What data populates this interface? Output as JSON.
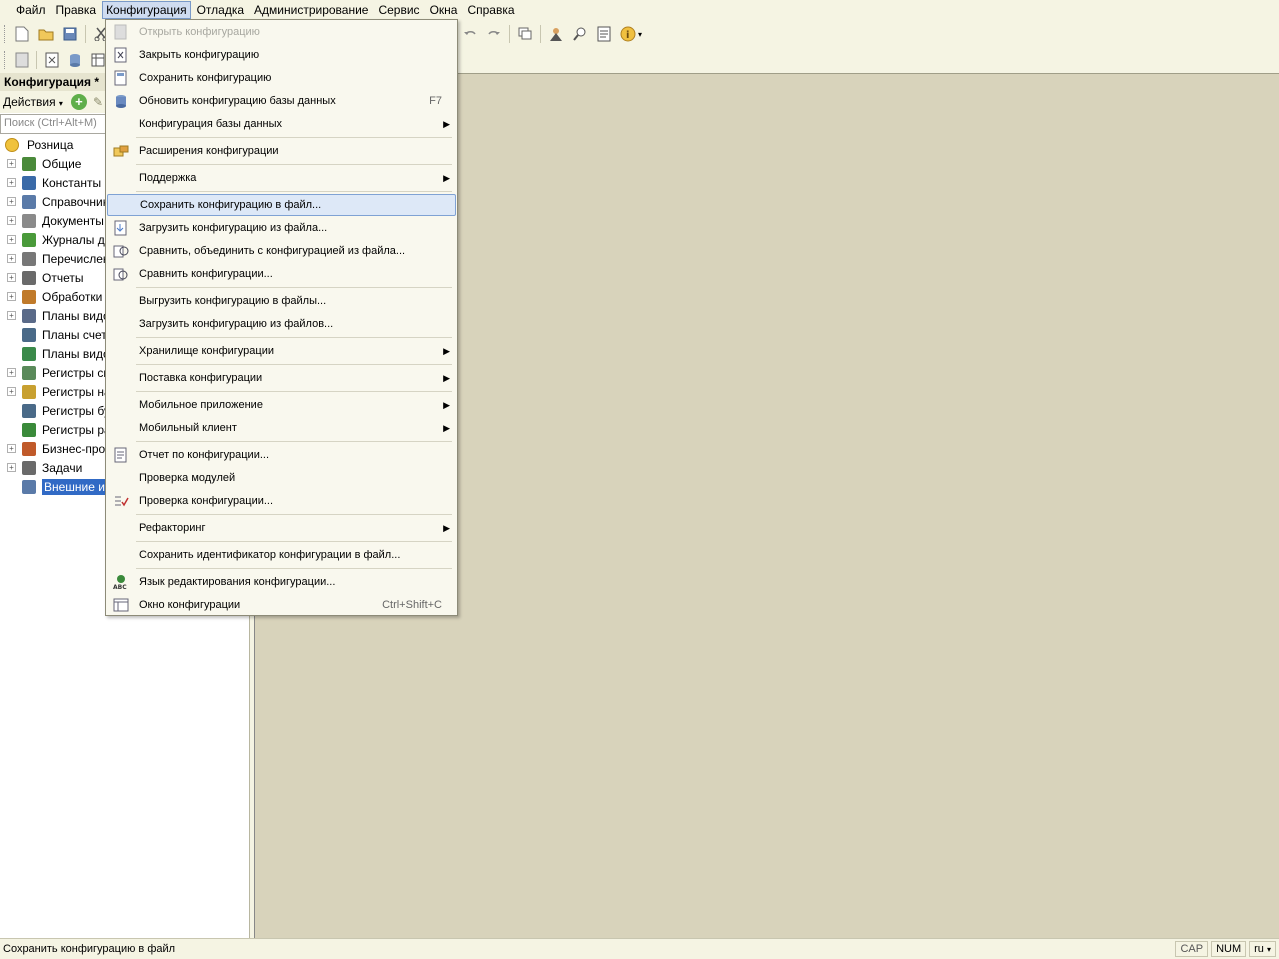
{
  "menubar": {
    "items": [
      "Файл",
      "Правка",
      "Конфигурация",
      "Отладка",
      "Администрирование",
      "Сервис",
      "Окна",
      "Справка"
    ]
  },
  "panel": {
    "title": "Конфигурация *",
    "actions_label": "Действия",
    "search_placeholder": "Поиск (Ctrl+Alt+M)"
  },
  "tree": {
    "root": "Розница",
    "items": [
      {
        "label": "Общие",
        "expandable": true,
        "icon_color": "#4a8a3a"
      },
      {
        "label": "Константы",
        "expandable": true,
        "icon_color": "#3a6aa8"
      },
      {
        "label": "Справочник",
        "expandable": true,
        "icon_color": "#5a7aa8"
      },
      {
        "label": "Документы",
        "expandable": true,
        "icon_color": "#8a8a8a"
      },
      {
        "label": "Журналы до",
        "expandable": true,
        "icon_color": "#4a9a3a"
      },
      {
        "label": "Перечислен",
        "expandable": true,
        "icon_color": "#777777"
      },
      {
        "label": "Отчеты",
        "expandable": true,
        "icon_color": "#6a6a6a"
      },
      {
        "label": "Обработки",
        "expandable": true,
        "icon_color": "#c07a2a"
      },
      {
        "label": "Планы видо",
        "expandable": true,
        "icon_color": "#5a6a88"
      },
      {
        "label": "Планы счето",
        "expandable": false,
        "icon_color": "#4a6a88"
      },
      {
        "label": "Планы видо",
        "expandable": false,
        "icon_color": "#3a8a4a"
      },
      {
        "label": "Регистры св",
        "expandable": true,
        "icon_color": "#5a8a5a"
      },
      {
        "label": "Регистры на",
        "expandable": true,
        "icon_color": "#c8a030"
      },
      {
        "label": "Регистры бу",
        "expandable": false,
        "icon_color": "#4a6a88"
      },
      {
        "label": "Регистры ра",
        "expandable": false,
        "icon_color": "#3a8a3a"
      },
      {
        "label": "Бизнес-проц",
        "expandable": true,
        "icon_color": "#c05a2a"
      },
      {
        "label": "Задачи",
        "expandable": true,
        "icon_color": "#6a6a6a"
      },
      {
        "label": "Внешние ис",
        "expandable": false,
        "icon_color": "#5a7aa8",
        "selected": true
      }
    ]
  },
  "menu": {
    "items": [
      {
        "label": "Открыть конфигурацию",
        "disabled": true,
        "icon": "open-config-icon"
      },
      {
        "label": "Закрыть конфигурацию",
        "icon": "close-config-icon"
      },
      {
        "label": "Сохранить конфигурацию",
        "icon": "save-config-icon"
      },
      {
        "label": "Обновить конфигурацию базы данных",
        "shortcut": "F7",
        "icon": "update-db-icon"
      },
      {
        "label": "Конфигурация базы данных",
        "submenu": true
      },
      {
        "label": "Расширения конфигурации",
        "icon": "extensions-icon"
      },
      {
        "label": "Поддержка",
        "submenu": true
      },
      {
        "label": "Сохранить конфигурацию в файл...",
        "highlighted": true
      },
      {
        "label": "Загрузить конфигурацию из файла...",
        "icon": "load-file-icon"
      },
      {
        "label": "Сравнить, объединить с конфигурацией из файла...",
        "icon": "compare-merge-icon"
      },
      {
        "label": "Сравнить конфигурации...",
        "icon": "compare-icon"
      },
      {
        "label": "Выгрузить конфигурацию в файлы..."
      },
      {
        "label": "Загрузить конфигурацию из файлов..."
      },
      {
        "label": "Хранилище конфигурации",
        "submenu": true
      },
      {
        "label": "Поставка конфигурации",
        "submenu": true
      },
      {
        "label": "Мобильное приложение",
        "submenu": true
      },
      {
        "label": "Мобильный клиент",
        "submenu": true
      },
      {
        "label": "Отчет по конфигурации...",
        "icon": "report-icon"
      },
      {
        "label": "Проверка модулей"
      },
      {
        "label": "Проверка конфигурации...",
        "icon": "check-icon"
      },
      {
        "label": "Рефакторинг",
        "submenu": true
      },
      {
        "label": "Сохранить идентификатор конфигурации в файл..."
      },
      {
        "label": "Язык редактирования конфигурации...",
        "icon": "abc-language-icon"
      },
      {
        "label": "Окно конфигурации",
        "shortcut": "Ctrl+Shift+C",
        "icon": "config-window-icon"
      }
    ]
  },
  "status": {
    "text": "Сохранить конфигурацию в файл",
    "cap": "CAP",
    "num": "NUM",
    "lang": "ru"
  }
}
